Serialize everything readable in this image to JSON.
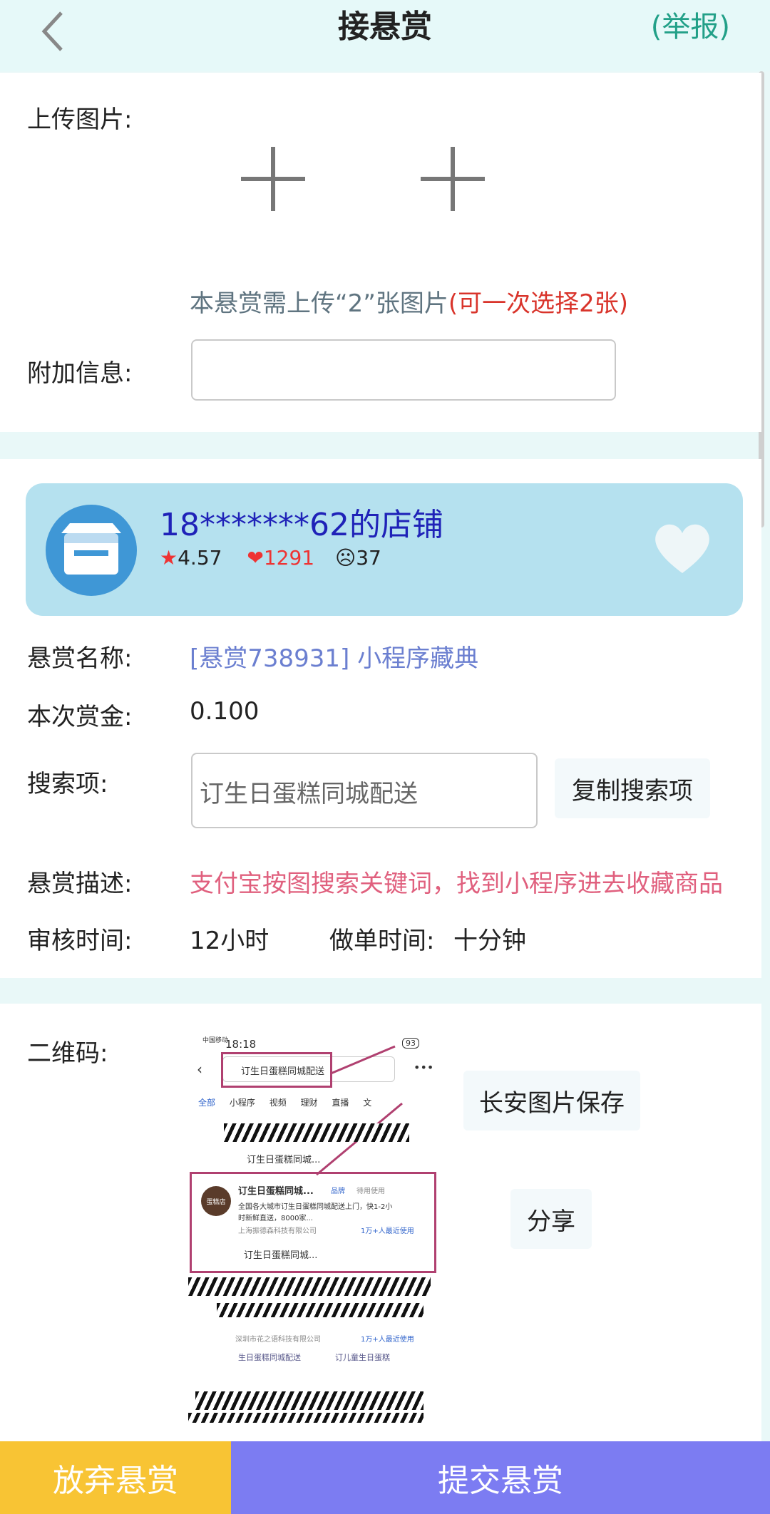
{
  "header": {
    "title": "接悬赏",
    "report": "(举报)"
  },
  "upload": {
    "label": "上传图片:",
    "hint_main": "本悬赏需上传“2”张图片",
    "hint_red": "(可一次选择2张)",
    "extra_label": "附加信息:",
    "extra_value": ""
  },
  "shop": {
    "name": "18*******62的店铺",
    "rating": "4.57",
    "likes": "1291",
    "dislikes": "37",
    "star_glyph": "★",
    "heart_glyph": "❤",
    "sad_glyph": "☹"
  },
  "task": {
    "name_label": "悬赏名称:",
    "name_value": "[悬赏738931] 小程序藏典",
    "reward_label": "本次赏金:",
    "reward_value": "0.100",
    "search_label": "搜索项:",
    "search_value": "订生日蛋糕同城配送",
    "copy_button": "复制搜索项",
    "desc_label": "悬赏描述:",
    "desc_value": "支付宝按图搜索关键词，找到小程序进去收藏商品",
    "review_label": "审核时间:",
    "review_value": "12小时",
    "work_label": "做单时间:",
    "work_value": "十分钟"
  },
  "qr": {
    "label": "二维码:",
    "save_button": "长安图片保存",
    "share_button": "分享",
    "screenshot": {
      "time": "18:18",
      "carrier": "中国移动",
      "battery": "93",
      "search_text": "订生日蛋糕同城配送",
      "tabs": [
        "全部",
        "小程序",
        "视频",
        "理财",
        "直播",
        "文"
      ],
      "result_title": "订生日蛋糕同城...",
      "result_tag": "品牌",
      "result_sub": "待用使用",
      "result_desc_1": "全国各大城市订生日蛋糕同城配送上门，快1-2小",
      "result_desc_2": "时新鲜直送，8000家...",
      "result_company": "上海振德森科技有限公司",
      "result_users": "1万+人最近使用",
      "result_link": "订生日蛋糕同城...",
      "link_above": "订生日蛋糕同城...",
      "company_2": "深圳市花之语科技有限公司",
      "users_2": "1万+人最近使用",
      "link_2a": "生日蛋糕同城配送",
      "link_2b": "订儿童生日蛋糕",
      "shop_badge": "蛋糕店"
    }
  },
  "bottom": {
    "abandon": "放弃悬赏",
    "submit": "提交悬赏"
  },
  "colors": {
    "accent_green": "#22a088",
    "link_blue": "#6b7fd0",
    "desc_pink": "#e0607e",
    "hint_red": "#d9342b",
    "abandon_bg": "#f8c434",
    "submit_bg": "#7c7cf2"
  }
}
